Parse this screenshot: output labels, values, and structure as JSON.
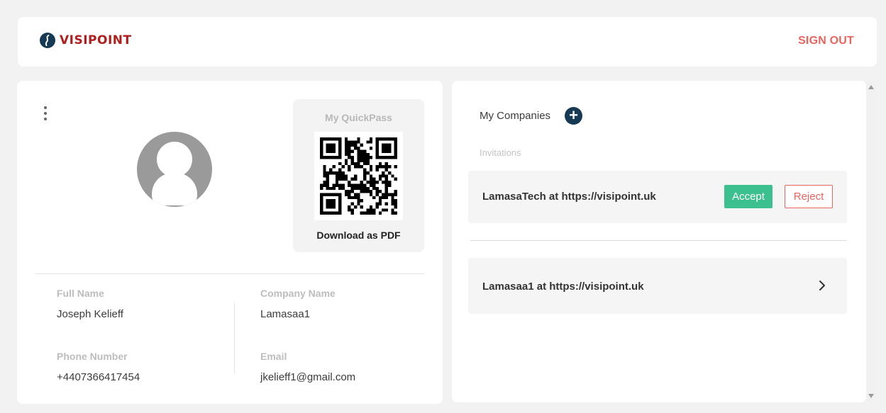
{
  "header": {
    "logo_text": "VISIPOINT",
    "signout_label": "SIGN OUT"
  },
  "profile": {
    "quickpass_title": "My QuickPass",
    "download_label": "Download as PDF",
    "fields": {
      "full_name_label": "Full Name",
      "full_name_value": "Joseph Kelieff",
      "company_label": "Company Name",
      "company_value": "Lamasaa1",
      "phone_label": "Phone Number",
      "phone_value": "+4407366417454",
      "email_label": "Email",
      "email_value": "jkelieff1@gmail.com"
    }
  },
  "companies": {
    "title": "My Companies",
    "add_glyph": "+",
    "invitations_label": "Invitations",
    "invitation": {
      "text": "LamasaTech at https://visipoint.uk",
      "accept_label": "Accept",
      "reject_label": "Reject"
    },
    "company_item": {
      "text": "Lamasaa1 at https://visipoint.uk"
    }
  },
  "colors": {
    "brand": "#b01e1e",
    "signout": "#e8655f",
    "accept": "#3cc08f",
    "reject": "#e8655f",
    "add_button": "#163a54"
  }
}
